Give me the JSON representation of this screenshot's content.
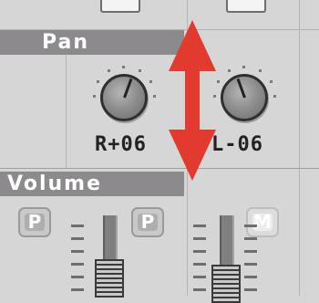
{
  "sections": {
    "pan_label": "Pan",
    "volume_label": "Volume"
  },
  "channels": [
    {
      "pan_value": "R+06",
      "pan_button": "P"
    },
    {
      "pan_value": "L-06",
      "pan_button": "P"
    }
  ],
  "extra_buttons": [
    "P",
    "M"
  ],
  "colors": {
    "background": "#d6d6d6",
    "section_header": "#8c8a8c",
    "arrow": "#e23a2e"
  },
  "overlay": {
    "icon": "double-vertical-arrow-icon"
  }
}
